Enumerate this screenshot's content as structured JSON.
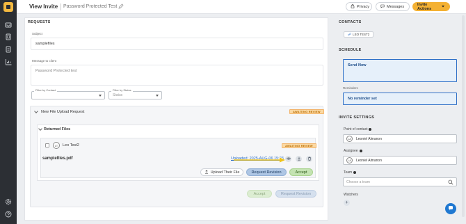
{
  "header": {
    "page_title": "View Invite",
    "invite_name": "Password Protected Test",
    "privacy_label": "Privacy",
    "messages_label": "Messages",
    "actions_label": "Invite Actions"
  },
  "requests": {
    "section_title": "REQUESTS",
    "subject_label": "Subject",
    "subject_value": "samplefiles",
    "message_label": "Message to client",
    "message_placeholder": "Password Protected test",
    "filter_contact_label": "Filter by Contact",
    "filter_contact_value": "",
    "filter_status_label": "Filter by Status",
    "filter_status_value": "Status",
    "request": {
      "title": "New File Upload Request",
      "status": "AWAITING REVIEW",
      "returned_files_label": "Returned Files",
      "file": {
        "contact_initials": "LT",
        "contact_name": "Leo Test2",
        "status": "AWAITING REVIEW",
        "file_name": "samplefiles.pdf",
        "uploaded_text": "Uploaded: 2025-AUG-06 15:23"
      },
      "upload_button": "Upload Their File",
      "request_revision_button": "Request Revision",
      "accept_button": "Accept",
      "accept_all_button": "Accept",
      "request_revision_all_button": "Request Revision"
    }
  },
  "contacts": {
    "section_title": "CONTACTS",
    "chip_label": "LEO TEST2"
  },
  "schedule": {
    "section_title": "SCHEDULE",
    "send_value": "Send Now",
    "reminders_label": "Reminders",
    "reminder_value": "No reminder set"
  },
  "invite_settings": {
    "section_title": "INVITE SETTINGS",
    "poc_label": "Point of contact",
    "poc_initials": "LA",
    "poc_value": "Leoniel Almanon",
    "assignee_label": "Assignee",
    "assignee_initials": "LA",
    "assignee_value": "Leoniel Almanon",
    "team_label": "Team",
    "team_placeholder": "Choose a team",
    "watchers_label": "Watchers",
    "add_watcher": "+"
  },
  "colors": {
    "accent": "#f4b132",
    "awaiting_badge": "#fbd9a3",
    "schedule_border": "#2f70c7",
    "request_revision": "#aec6e4",
    "accept": "#c4e3b2",
    "arrow": "#f0c419"
  }
}
